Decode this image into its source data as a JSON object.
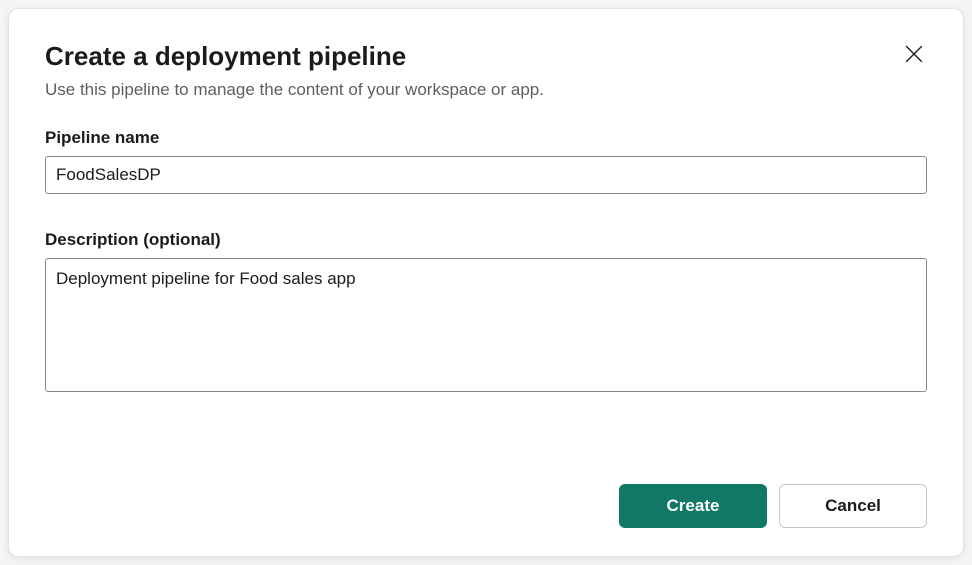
{
  "dialog": {
    "title": "Create a deployment pipeline",
    "subtitle": "Use this pipeline to manage the content of your workspace or app."
  },
  "fields": {
    "pipelineName": {
      "label": "Pipeline name",
      "value": "FoodSalesDP"
    },
    "description": {
      "label": "Description (optional)",
      "value": "Deployment pipeline for Food sales app"
    }
  },
  "buttons": {
    "create": "Create",
    "cancel": "Cancel"
  },
  "colors": {
    "primary": "#117865"
  }
}
